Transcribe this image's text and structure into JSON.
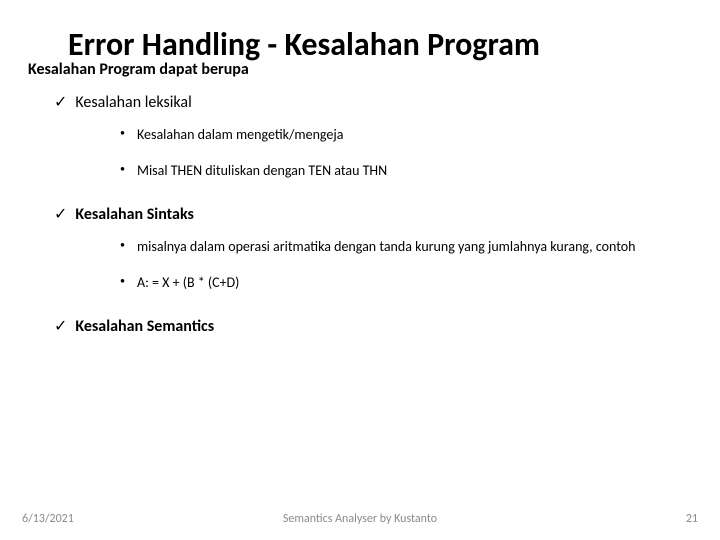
{
  "title": "Error Handling - Kesalahan Program",
  "subtitle": "Kesalahan Program dapat berupa",
  "sections": [
    {
      "label": "Kesalahan leksikal",
      "bold": false,
      "items": [
        "Kesalahan dalam mengetik/mengeja",
        "Misal THEN dituliskan dengan TEN atau THN"
      ]
    },
    {
      "label": "Kesalahan Sintaks",
      "bold": true,
      "items": [
        "misalnya dalam  operasi aritmatika dengan tanda kurung yang jumlahnya kurang, contoh",
        "A: = X + (B * (C+D)"
      ]
    },
    {
      "label": "Kesalahan Semantics",
      "bold": true,
      "items": []
    }
  ],
  "footer": {
    "date": "6/13/2021",
    "center": "Semantics Analyser by Kustanto",
    "page": "21"
  },
  "glyphs": {
    "check": "✓",
    "dot": "•"
  }
}
